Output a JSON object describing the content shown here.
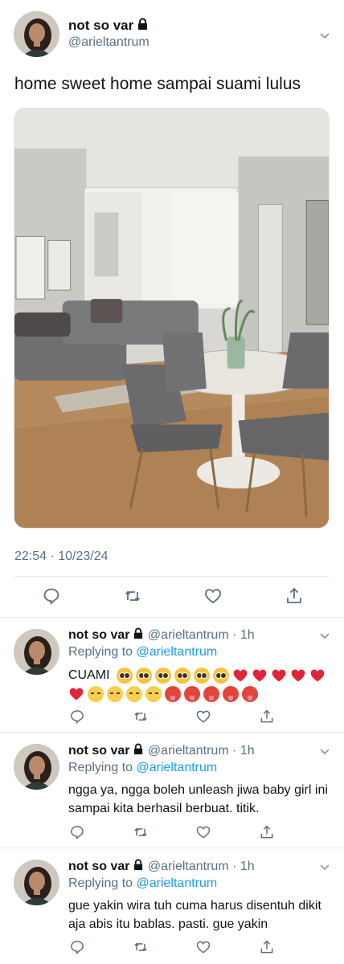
{
  "main_tweet": {
    "display_name": "not so var",
    "handle": "@arieltantrum",
    "text": "home sweet home sampai suami lulus",
    "timestamp": "22:54 · 10/23/24",
    "icons": [
      "lock-icon",
      "chevron-down-icon",
      "reply-icon",
      "retweet-icon",
      "like-icon",
      "share-icon"
    ]
  },
  "replies": [
    {
      "display_name": "not so var",
      "meta": "@arieltantrum · 1h",
      "replying_label": "Replying to",
      "replying_to": "@arieltantrum",
      "text": "CUAMI",
      "emoji_line1": [
        "pleading",
        "pleading",
        "pleading",
        "pleading",
        "pleading",
        "pleading",
        "heart",
        "heart",
        "heart",
        "heart",
        "heart"
      ],
      "emoji_line2": [
        "heart",
        "sad",
        "sad",
        "sad",
        "sad",
        "hot",
        "hot",
        "hot",
        "hot",
        "hot"
      ]
    },
    {
      "display_name": "not so var",
      "meta": "@arieltantrum · 1h",
      "replying_label": "Replying to",
      "replying_to": "@arieltantrum",
      "text": "ngga ya, ngga boleh unleash jiwa baby girl ini sampai kita berhasil berbuat. titik."
    },
    {
      "display_name": "not so var",
      "meta": "@arieltantrum · 1h",
      "replying_label": "Replying to",
      "replying_to": "@arieltantrum",
      "text": "gue yakin wira tuh cuma harus disentuh dikit aja abis itu bablas. pasti. gue yakin"
    }
  ],
  "colors": {
    "secondary_text": "#5b7083",
    "link": "#1d9bf0",
    "divider": "#e6ecf0"
  }
}
